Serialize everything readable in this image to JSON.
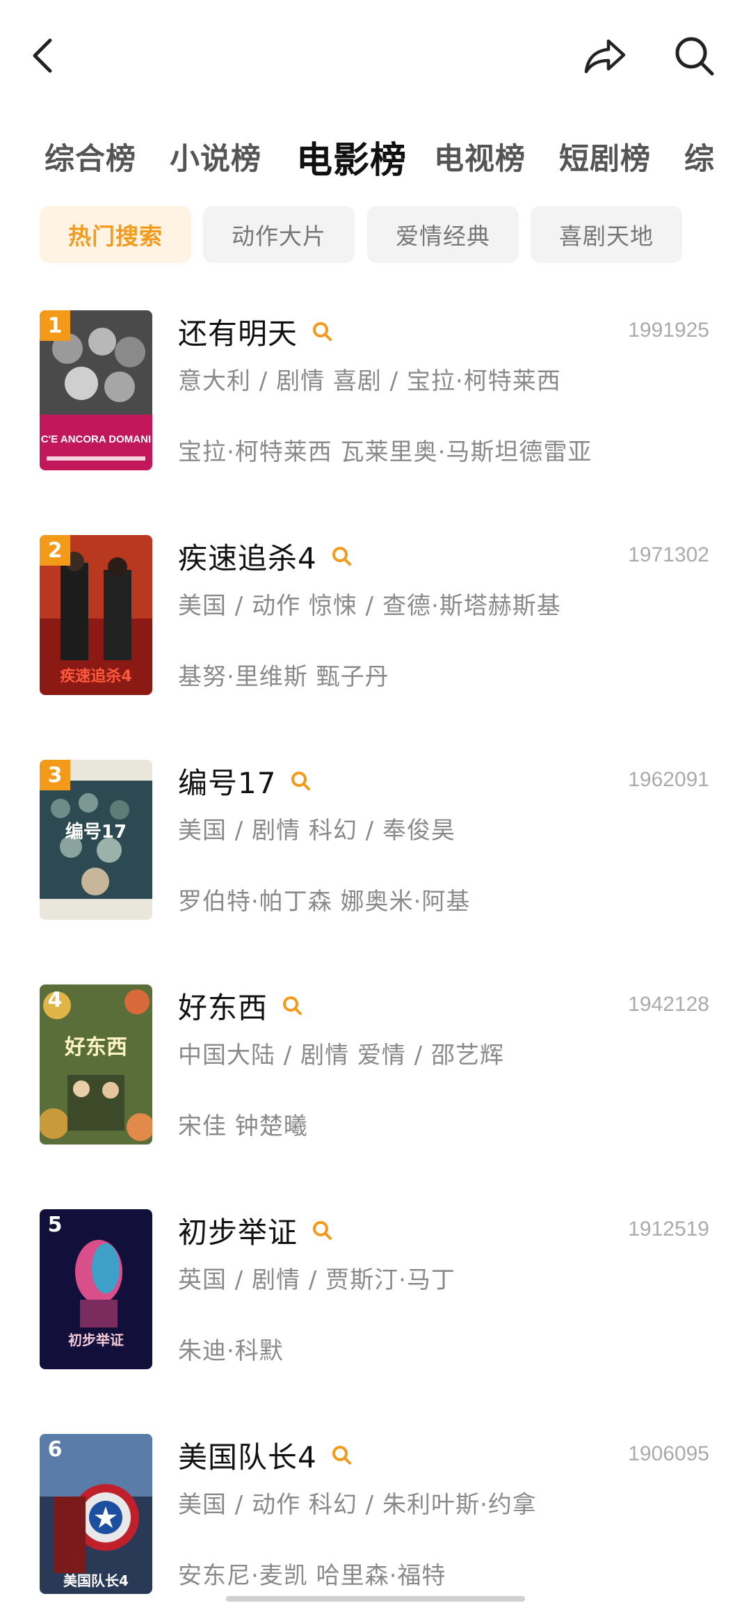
{
  "header": {
    "back_icon": "chevron-left-icon",
    "share_icon": "share-arrow-icon",
    "search_icon": "search-icon"
  },
  "tabs": [
    {
      "label": "综合榜",
      "active": false
    },
    {
      "label": "小说榜",
      "active": false
    },
    {
      "label": "电影榜",
      "active": true
    },
    {
      "label": "电视榜",
      "active": false
    },
    {
      "label": "短剧榜",
      "active": false
    },
    {
      "label": "综",
      "active": false
    }
  ],
  "chips": [
    {
      "label": "热门搜索",
      "active": true
    },
    {
      "label": "动作大片",
      "active": false
    },
    {
      "label": "爱情经典",
      "active": false
    },
    {
      "label": "喜剧天地",
      "active": false
    }
  ],
  "accent_color": "#F39A1A",
  "movies": [
    {
      "rank": "1",
      "title": "还有明天",
      "count": "1991925",
      "meta": "意大利 / 剧情 喜剧 / 宝拉·柯特莱西",
      "cast": "宝拉·柯特莱西 瓦莱里奥·马斯坦德雷亚",
      "poster_text": "C'E ANCORA DOMANI"
    },
    {
      "rank": "2",
      "title": "疾速追杀4",
      "count": "1971302",
      "meta": "美国 / 动作 惊悚 / 查德·斯塔赫斯基",
      "cast": "基努·里维斯 甄子丹",
      "poster_text": "疾速追杀4"
    },
    {
      "rank": "3",
      "title": "编号17",
      "count": "1962091",
      "meta": "美国 / 剧情 科幻 / 奉俊昊",
      "cast": "罗伯特·帕丁森 娜奥米·阿基",
      "poster_text": "编号17"
    },
    {
      "rank": "4",
      "title": "好东西",
      "count": "1942128",
      "meta": "中国大陆 / 剧情 爱情 / 邵艺辉",
      "cast": "宋佳 钟楚曦",
      "poster_text": "好东西"
    },
    {
      "rank": "5",
      "title": "初步举证",
      "count": "1912519",
      "meta": "英国 / 剧情 / 贾斯汀·马丁",
      "cast": "朱迪·科默",
      "poster_text": "初步举证"
    },
    {
      "rank": "6",
      "title": "美国队长4",
      "count": "1906095",
      "meta": "美国 / 动作 科幻 / 朱利叶斯·约拿",
      "cast": "安东尼·麦凯 哈里森·福特",
      "poster_text": "美国队长4"
    }
  ]
}
